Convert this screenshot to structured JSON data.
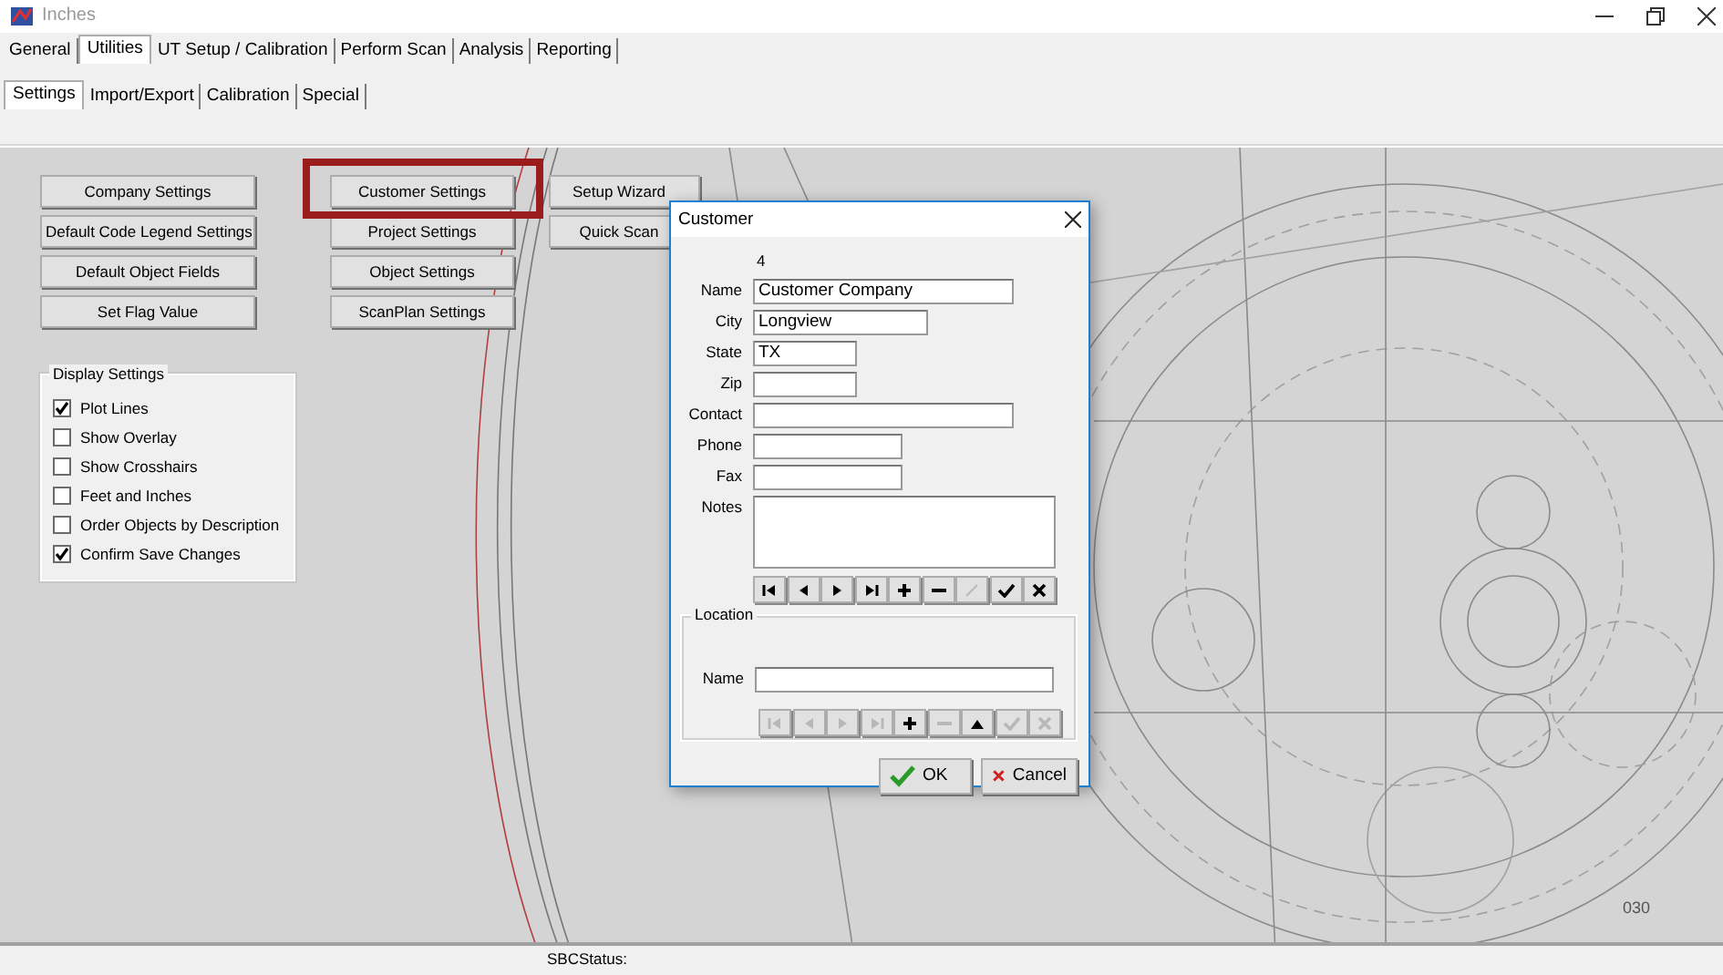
{
  "window": {
    "title": "Inches"
  },
  "main_tabs": [
    {
      "label": "General",
      "selected": false
    },
    {
      "label": "Utilities",
      "selected": true
    },
    {
      "label": "UT Setup / Calibration",
      "selected": false
    },
    {
      "label": "Perform Scan",
      "selected": false
    },
    {
      "label": "Analysis",
      "selected": false
    },
    {
      "label": "Reporting",
      "selected": false
    }
  ],
  "sub_tabs": [
    {
      "label": "Settings",
      "selected": true
    },
    {
      "label": "Import/Export",
      "selected": false
    },
    {
      "label": "Calibration",
      "selected": false
    },
    {
      "label": "Special",
      "selected": false
    }
  ],
  "button_columns": [
    [
      {
        "label": "Company Settings",
        "highlighted": false
      },
      {
        "label": "Default Code Legend Settings",
        "highlighted": false
      },
      {
        "label": "Default Object Fields",
        "highlighted": false
      },
      {
        "label": "Set Flag Value",
        "highlighted": false
      }
    ],
    [
      {
        "label": "Customer Settings",
        "highlighted": true
      },
      {
        "label": "Project Settings",
        "highlighted": false
      },
      {
        "label": "Object Settings",
        "highlighted": false
      },
      {
        "label": "ScanPlan Settings",
        "highlighted": false
      }
    ],
    [
      {
        "label": "Setup Wizard",
        "highlighted": false
      },
      {
        "label": "Quick Scan",
        "highlighted": false
      }
    ]
  ],
  "display_settings": {
    "title": "Display Settings",
    "options": [
      {
        "label": "Plot Lines",
        "checked": true
      },
      {
        "label": "Show Overlay",
        "checked": false
      },
      {
        "label": "Show Crosshairs",
        "checked": false
      },
      {
        "label": "Feet and Inches",
        "checked": false
      },
      {
        "label": "Order Objects by Description",
        "checked": false
      },
      {
        "label": "Confirm Save Changes",
        "checked": true
      }
    ]
  },
  "drawing": {
    "label": "030"
  },
  "dialog": {
    "title": "Customer",
    "record_number": "4",
    "fields": [
      {
        "label": "Name",
        "value": "Customer Company",
        "kind": "wide"
      },
      {
        "label": "City",
        "value": "Longview",
        "kind": "medium"
      },
      {
        "label": "State",
        "value": "TX",
        "kind": "narrow"
      },
      {
        "label": "Zip",
        "kind": "narrow"
      },
      {
        "label": "Contact",
        "kind": "wide"
      },
      {
        "label": "Phone",
        "kind": "phone"
      },
      {
        "label": "Fax",
        "kind": "phone"
      },
      {
        "label": "Notes",
        "kind": "multiline"
      }
    ],
    "navigator": [
      {
        "kind": "first",
        "disabled": false
      },
      {
        "kind": "prev",
        "disabled": false
      },
      {
        "kind": "next",
        "disabled": false
      },
      {
        "kind": "last",
        "disabled": false
      },
      {
        "kind": "add",
        "disabled": false
      },
      {
        "kind": "delete",
        "disabled": false
      },
      {
        "kind": "edit",
        "disabled": true
      },
      {
        "kind": "post",
        "disabled": false
      },
      {
        "kind": "cancel",
        "disabled": false
      }
    ],
    "location": {
      "title": "Location",
      "fields": [
        {
          "label": "Name",
          "kind": "full"
        }
      ],
      "navigator": [
        {
          "kind": "first",
          "disabled": true
        },
        {
          "kind": "prev",
          "disabled": true
        },
        {
          "kind": "next",
          "disabled": true
        },
        {
          "kind": "last",
          "disabled": true
        },
        {
          "kind": "add",
          "disabled": false
        },
        {
          "kind": "delete",
          "disabled": true
        },
        {
          "kind": "up",
          "disabled": false
        },
        {
          "kind": "post",
          "disabled": true
        },
        {
          "kind": "cancel",
          "disabled": true
        }
      ]
    },
    "buttons": [
      {
        "kind": "ok",
        "label": "OK"
      },
      {
        "kind": "cancel",
        "label": "Cancel"
      }
    ]
  },
  "status_bar": {
    "text": "SBCStatus:"
  }
}
